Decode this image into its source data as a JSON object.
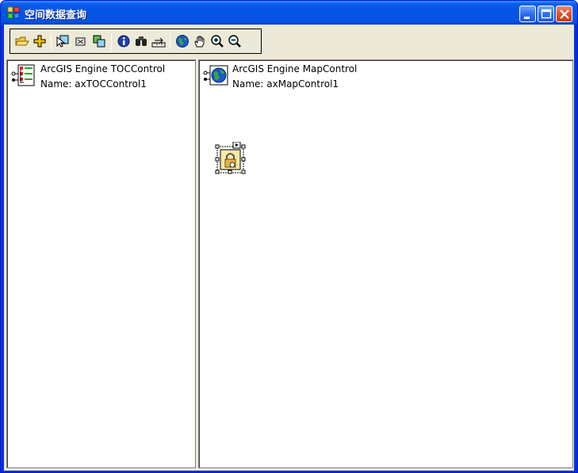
{
  "window": {
    "title": "空间数据查询",
    "controls": {
      "minimize": "minimize",
      "maximize": "maximize",
      "close": "close"
    }
  },
  "toolbar": {
    "tools": [
      {
        "name": "open-document-icon"
      },
      {
        "name": "add-data-icon"
      },
      {
        "name": "select-features-icon"
      },
      {
        "name": "select-elements-icon"
      },
      {
        "name": "select-by-graphics-icon"
      },
      {
        "name": "identify-icon"
      },
      {
        "name": "find-icon"
      },
      {
        "name": "measure-icon"
      },
      {
        "name": "full-extent-icon"
      },
      {
        "name": "pan-icon"
      },
      {
        "name": "zoom-in-icon"
      },
      {
        "name": "zoom-out-icon"
      }
    ]
  },
  "toc": {
    "control_type": "ArcGIS Engine TOCControl",
    "control_name": "Name: axTOCControl1"
  },
  "map": {
    "control_type": "ArcGIS Engine MapControl",
    "control_name": "Name: axMapControl1"
  },
  "colors": {
    "titlebar": "#0554e3",
    "frame": "#0831d9",
    "client": "#ece9d8",
    "close_button": "#e0522b"
  }
}
